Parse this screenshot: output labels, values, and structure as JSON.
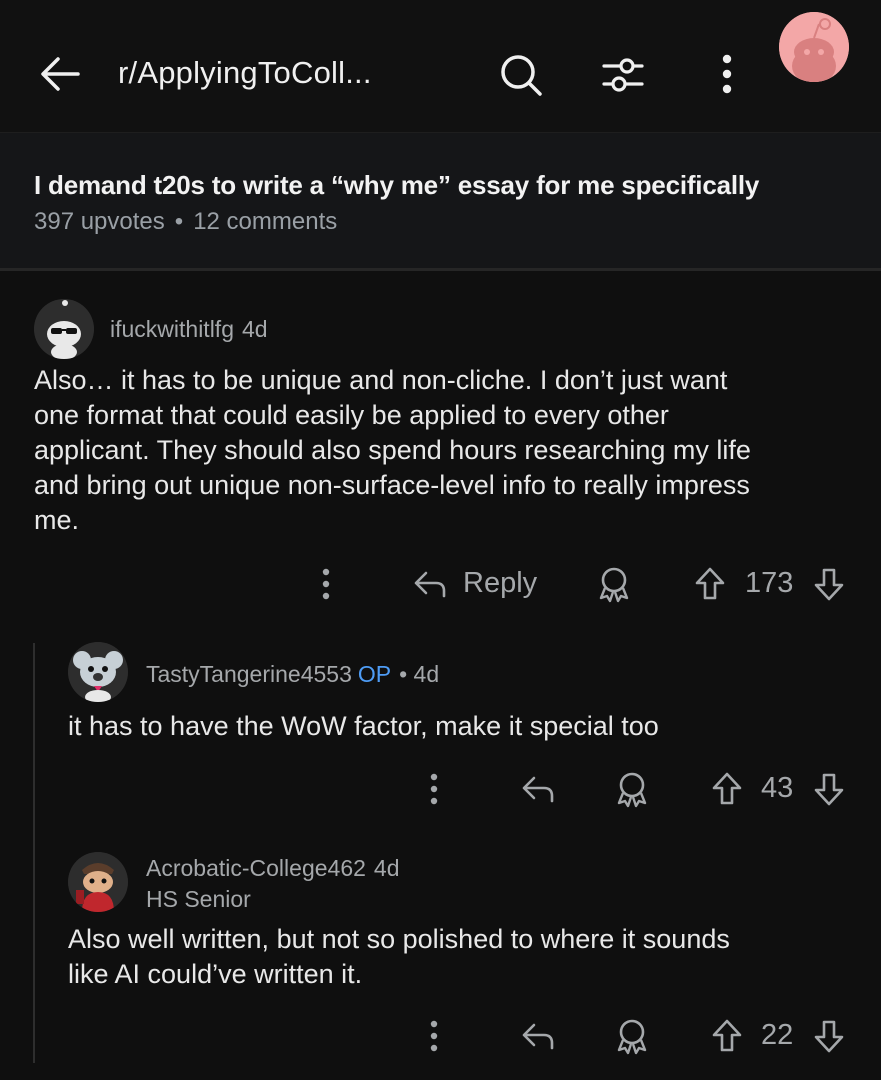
{
  "header": {
    "subreddit": "r/ApplyingToColl...",
    "back_icon": "arrow-left-icon",
    "search_icon": "search-icon",
    "filter_icon": "filter-icon",
    "more_icon": "more-vertical-icon",
    "avatar_icon": "reddit-avatar-icon"
  },
  "post": {
    "title": "I demand t20s to write a “why me” essay for me specifically",
    "upvotes": "397 upvotes",
    "separator": "•",
    "comments": "12 comments"
  },
  "comments": [
    {
      "username": "ifuckwithitlfg",
      "age": "4d",
      "lines": [
        "Also… it has to be unique and non-cliche. I don’t just want",
        "one format that could easily be applied to every other",
        "applicant. They should also spend hours researching my life",
        "and bring out unique non-surface-level info to really impress",
        "me."
      ],
      "reply_label": "Reply",
      "score": "173"
    },
    {
      "username": "TastyTangerine4553",
      "op_badge": "OP",
      "age": "• 4d",
      "lines": [
        "it has to have the WoW factor, make it special too"
      ],
      "score": "43"
    },
    {
      "username": "Acrobatic-College462",
      "age": "4d",
      "flair": "HS Senior",
      "lines": [
        "Also well written, but not so polished to where it sounds",
        "like AI could’ve written it."
      ],
      "score": "22"
    }
  ],
  "colors": {
    "background": "#0f0f0f",
    "op_badge": "#4e9cf5",
    "avatar_top": "#f3a7a7"
  }
}
